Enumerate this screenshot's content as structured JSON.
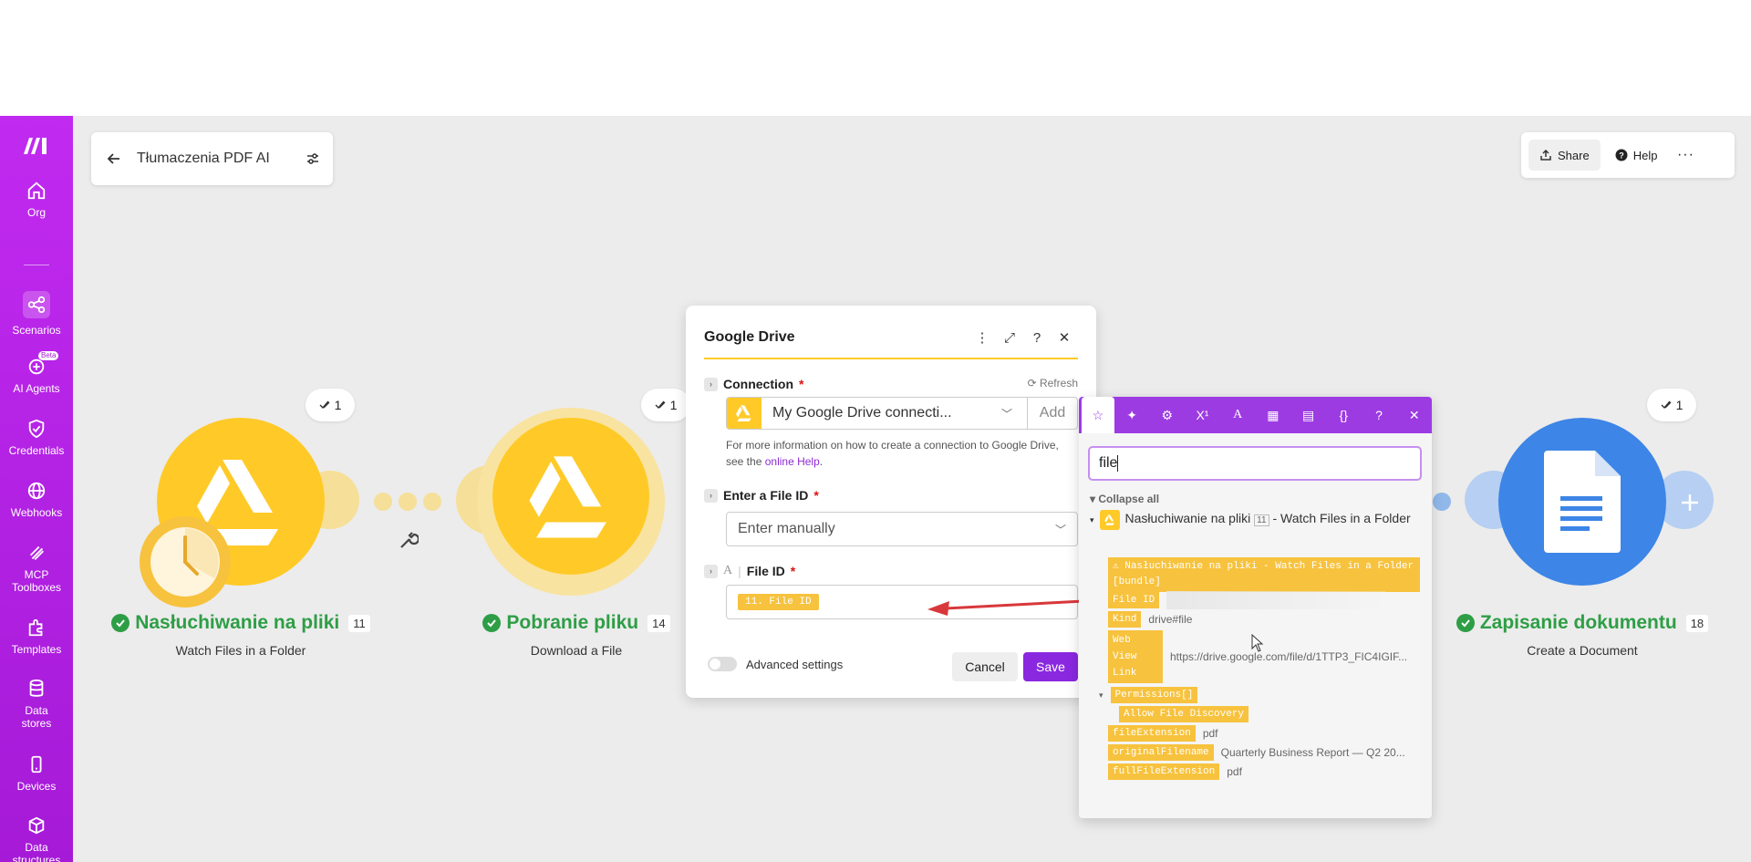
{
  "sidebar": {
    "logo": "make-logo",
    "items": [
      {
        "label": "Org",
        "icon": "home-icon"
      },
      {
        "label": "Scenarios",
        "icon": "share-nodes-icon"
      },
      {
        "label": "AI Agents",
        "icon": "ai-agent-icon",
        "badge": "Beta"
      },
      {
        "label": "Credentials",
        "icon": "shield-check-icon"
      },
      {
        "label": "Webhooks",
        "icon": "globe-icon"
      },
      {
        "label": "MCP Toolboxes",
        "icon": "toolbox-icon"
      },
      {
        "label": "Templates",
        "icon": "puzzle-icon"
      },
      {
        "label": "Data stores",
        "icon": "database-icon"
      },
      {
        "label": "Devices",
        "icon": "phone-icon"
      },
      {
        "label": "Data structures",
        "icon": "cube-icon"
      }
    ]
  },
  "header": {
    "scenario_title": "Tłumaczenia PDF AI",
    "share_label": "Share",
    "help_label": "Help"
  },
  "modules": [
    {
      "name": "Nasłuchiwanie na pliki",
      "id": "11",
      "subtitle": "Watch Files in a Folder",
      "ops": "1"
    },
    {
      "name": "Pobranie pliku",
      "id": "14",
      "subtitle": "Download a File",
      "ops": "1"
    },
    {
      "name": "Zapisanie dokumentu",
      "id": "18",
      "subtitle": "Create a Document",
      "ops": "1"
    }
  ],
  "dialog": {
    "title": "Google Drive",
    "connection_label": "Connection",
    "refresh_label": "Refresh",
    "connection_value": "My Google Drive connecti...",
    "add_label": "Add",
    "help_text": "For more information on how to create a connection to Google Drive, see the",
    "help_link": "online Help",
    "help_end": ".",
    "enter_file_label": "Enter a File ID",
    "enter_file_value": "Enter manually",
    "file_id_label": "File ID",
    "file_id_type": "A",
    "file_id_value": "11. File ID",
    "advanced_label": "Advanced settings",
    "cancel_label": "Cancel",
    "save_label": "Save"
  },
  "mapper": {
    "search_value": "file",
    "collapse_label": "Collapse all",
    "tree_title": "Nasłuchiwanie na pliki",
    "tree_count": "11",
    "tree_suffix": "- Watch Files in a Folder",
    "bundle_label": "Nasłuchiwanie na pliki - Watch Files in a Folder [bundle]",
    "rows": [
      {
        "key": "File ID",
        "value": ""
      },
      {
        "key": "Kind",
        "value": "drive#file"
      },
      {
        "key": "Web View Link",
        "value": "https://drive.google.com/file/d/1TTP3_FIC4IGIF..."
      },
      {
        "key": "Permissions[]",
        "value": ""
      },
      {
        "key": "Allow File Discovery",
        "value": ""
      },
      {
        "key": "fileExtension",
        "value": "pdf"
      },
      {
        "key": "originalFilename",
        "value": "Quarterly Business Report — Q2 20..."
      },
      {
        "key": "fullFileExtension",
        "value": "pdf"
      }
    ]
  },
  "colors": {
    "sidebar": "#bb1fe6",
    "drive_yellow": "#ffca28",
    "success_green": "#2e9e46",
    "docs_blue": "#3d85e6",
    "mapper_purple": "#9d3be3",
    "arrow_red": "#d8383b"
  }
}
